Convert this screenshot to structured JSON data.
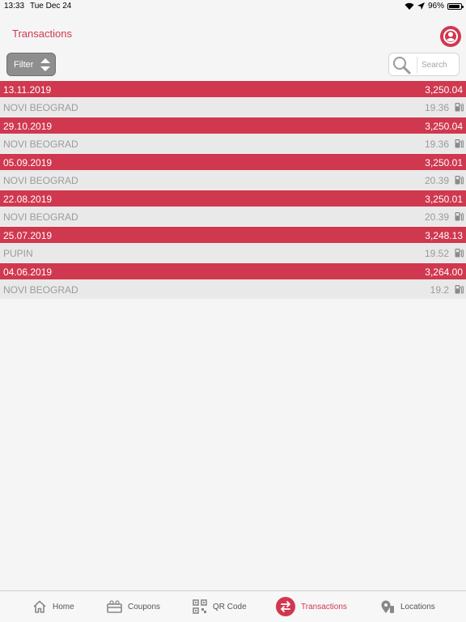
{
  "status_bar": {
    "time": "13:33",
    "date": "Tue Dec 24",
    "battery": "96%",
    "battery_level": 0.96
  },
  "header": {
    "title": "Transactions"
  },
  "toolbar": {
    "filter_label": "Filter",
    "search_placeholder": "Search"
  },
  "transactions": [
    {
      "date": "13.11.2019",
      "total": "3,250.04",
      "location": "NOVI BEOGRAD",
      "amount": "19.36"
    },
    {
      "date": "29.10.2019",
      "total": "3,250.04",
      "location": "NOVI BEOGRAD",
      "amount": "19.36"
    },
    {
      "date": "05.09.2019",
      "total": "3,250.01",
      "location": "NOVI BEOGRAD",
      "amount": "20.39"
    },
    {
      "date": "22.08.2019",
      "total": "3,250.01",
      "location": "NOVI BEOGRAD",
      "amount": "20.39"
    },
    {
      "date": "25.07.2019",
      "total": "3,248.13",
      "location": "PUPIN",
      "amount": "19.52"
    },
    {
      "date": "04.06.2019",
      "total": "3,264.00",
      "location": "NOVI BEOGRAD",
      "amount": "19.2"
    }
  ],
  "tabs": [
    {
      "label": "Home",
      "icon": "home-icon"
    },
    {
      "label": "Coupons",
      "icon": "coupons-icon"
    },
    {
      "label": "QR Code",
      "icon": "qr-code-icon"
    },
    {
      "label": "Transactions",
      "icon": "transactions-icon",
      "active": true
    },
    {
      "label": "Locations",
      "icon": "locations-icon"
    }
  ],
  "colors": {
    "accent": "#d0384f",
    "row_gray": "#e9e9e9",
    "background": "#f5f5f5"
  }
}
